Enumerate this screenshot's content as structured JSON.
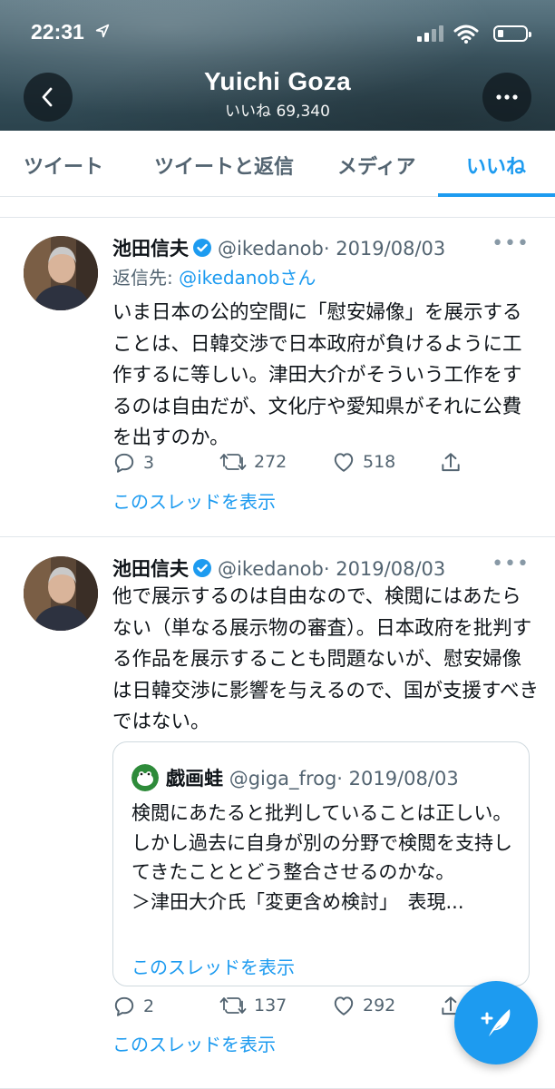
{
  "status_bar": {
    "time": "22:31"
  },
  "header": {
    "name": "Yuichi Goza",
    "subtitle": "いいね 69,340"
  },
  "tabs": [
    {
      "label": "ツイート"
    },
    {
      "label": "ツイートと返信"
    },
    {
      "label": "メディア"
    },
    {
      "label": "いいね",
      "active": true
    }
  ],
  "tweets": [
    {
      "name": "池田信夫",
      "handle": "@ikedanob",
      "date": "· 2019/08/03",
      "reply_prefix": "返信先: ",
      "reply_to": "@ikedanobさん",
      "text": "いま日本の公的空間に「慰安婦像」を展示することは、日韓交渉で日本政府が負けるように工作するに等しい。津田大介がそういう工作をするのは自由だが、文化庁や愛知県がそれに公費を出すのか。",
      "replies": "3",
      "retweets": "272",
      "likes": "518",
      "thread_link": "このスレッドを表示"
    },
    {
      "name": "池田信夫",
      "handle": "@ikedanob",
      "date": "· 2019/08/03",
      "text": "他で展示するのは自由なので、検閲にはあたらない（単なる展示物の審査）。日本政府を批判する作品を展示することも問題ないが、慰安婦像は日韓交渉に影響を与えるので、国が支援すべきではない。",
      "quote": {
        "name": "戯画蛙",
        "handle": "@giga_frog",
        "date": "· 2019/08/03",
        "text": "検閲にあたると批判していることは正しい。しかし過去に自身が別の分野で検閲を支持してきたこととどう整合させるのかな。\n＞津田大介氏「変更含め検討」　表現...",
        "thread_link": "このスレッドを表示"
      },
      "replies": "2",
      "retweets": "137",
      "likes": "292",
      "thread_link": "このスレッドを表示"
    }
  ],
  "colors": {
    "accent": "#1d9bf0",
    "secondary_text": "#536471",
    "header_bg": "#3d5864"
  }
}
